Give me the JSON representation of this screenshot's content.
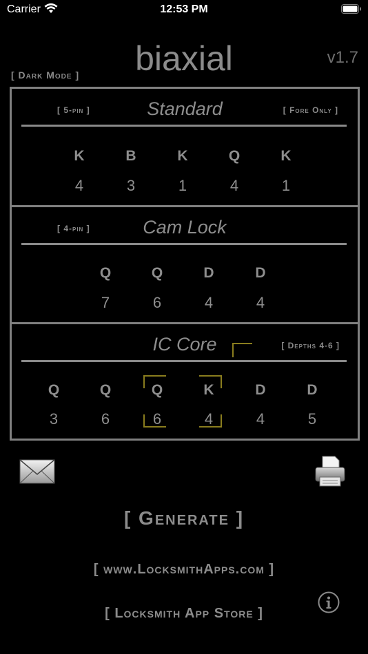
{
  "status_bar": {
    "carrier": "Carrier",
    "time": "12:53 PM",
    "icons": [
      "wifi-icon",
      "battery-icon"
    ]
  },
  "header": {
    "title": "biaxial",
    "version": "v1.7",
    "dark_mode_label": "[ Dark Mode ]"
  },
  "sections": [
    {
      "title": "Standard",
      "left_tag": "[ 5-pin ]",
      "right_tag": "[ Fore Only ]",
      "letters": [
        "K",
        "B",
        "K",
        "Q",
        "K"
      ],
      "depths": [
        "4",
        "3",
        "1",
        "4",
        "1"
      ]
    },
    {
      "title": "Cam Lock",
      "left_tag": "[ 4-pin ]",
      "letters": [
        "Q",
        "Q",
        "D",
        "D"
      ],
      "depths": [
        "7",
        "6",
        "4",
        "4"
      ]
    },
    {
      "title": "IC Core",
      "right_tag": "[ Depths 4-6 ]",
      "letters": [
        "Q",
        "Q",
        "Q",
        "K",
        "D",
        "D"
      ],
      "depths": [
        "3",
        "6",
        "6",
        "4",
        "4",
        "5"
      ],
      "highlighted_positions": [
        3,
        4
      ]
    }
  ],
  "actions": {
    "generate_label": "[ Generate ]",
    "website_label": "[ www.LocksmithApps.com ]",
    "store_label": "[ Locksmith App Store ]"
  },
  "colors": {
    "background": "#000000",
    "text": "#8a8a8a",
    "highlight_bracket": "#8a7d1e"
  }
}
